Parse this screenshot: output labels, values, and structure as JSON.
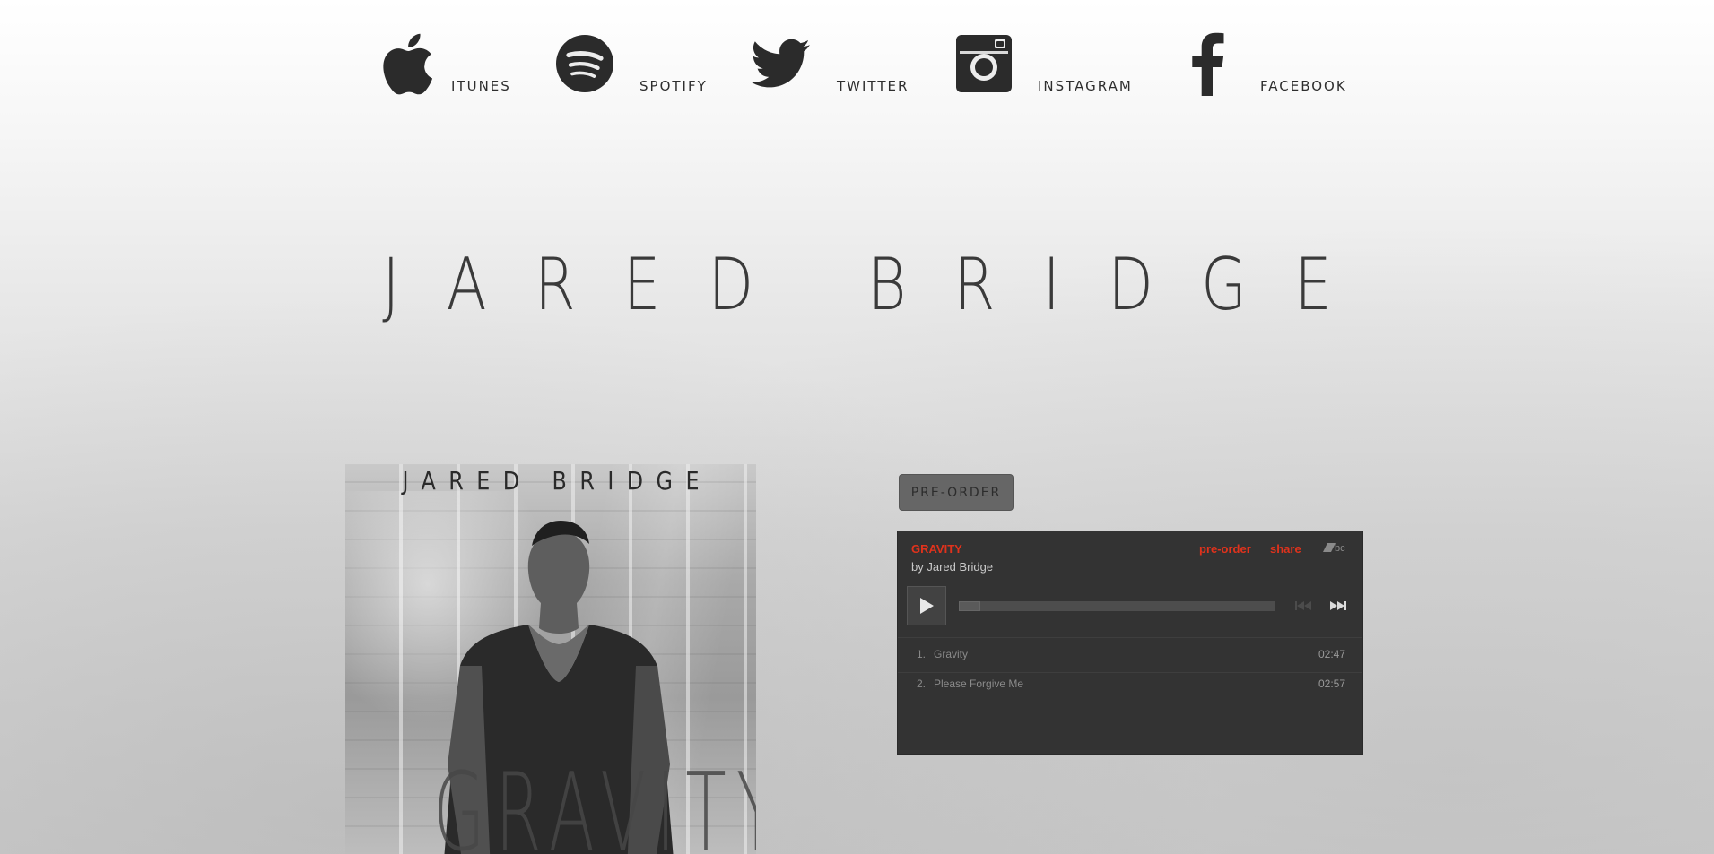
{
  "social": {
    "items": [
      {
        "label": "ITUNES",
        "icon": "apple-icon"
      },
      {
        "label": "SPOTIFY",
        "icon": "spotify-icon"
      },
      {
        "label": "TWITTER",
        "icon": "twitter-icon"
      },
      {
        "label": "INSTAGRAM",
        "icon": "instagram-icon"
      },
      {
        "label": "FACEBOOK",
        "icon": "facebook-icon"
      }
    ]
  },
  "artist_title": "JARED BRIDGE",
  "album_cover": {
    "artist": "JARED BRIDGE",
    "title": "GRAVITY"
  },
  "preorder_label": "PRE-ORDER",
  "player": {
    "album_name": "GRAVITY",
    "by_artist": "by Jared Bridge",
    "preorder_link": "pre-order",
    "share_link": "share",
    "progress": 0,
    "tracks": [
      {
        "num": "1.",
        "title": "Gravity",
        "time": "02:47"
      },
      {
        "num": "2.",
        "title": "Please Forgive Me",
        "time": "02:57"
      }
    ],
    "accent_color": "#e0321c",
    "background_color": "#333333"
  },
  "colors": {
    "icon": "#2b2b2b",
    "text": "#333333"
  }
}
